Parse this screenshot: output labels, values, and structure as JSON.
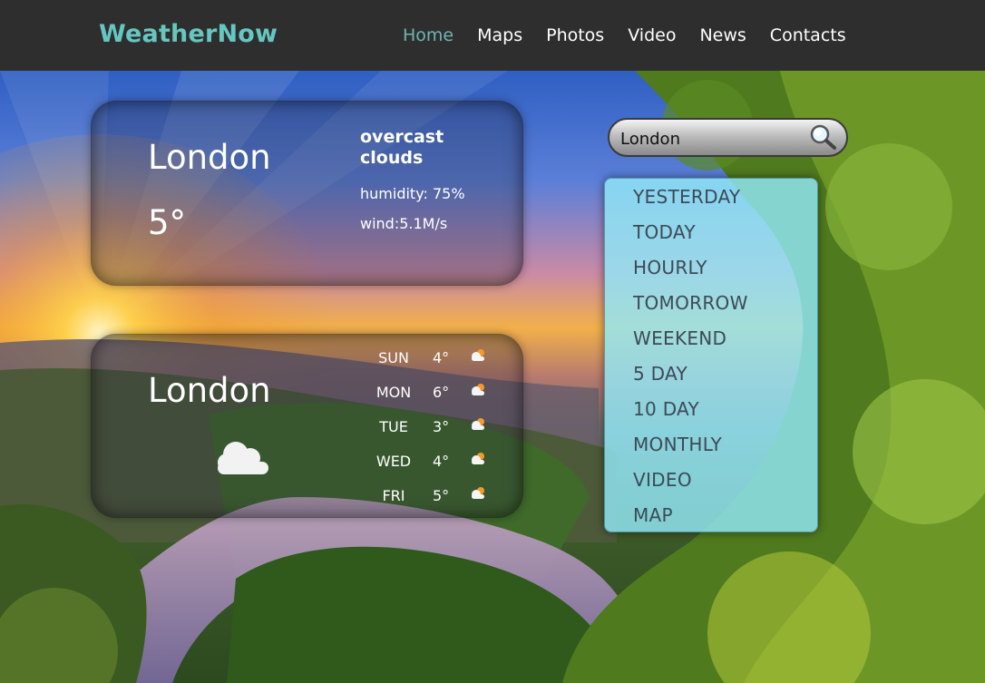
{
  "header": {
    "logo": "WeatherNow",
    "nav": [
      {
        "label": "Home",
        "active": true
      },
      {
        "label": "Maps"
      },
      {
        "label": "Photos"
      },
      {
        "label": "Video"
      },
      {
        "label": "News"
      },
      {
        "label": "Contacts"
      }
    ]
  },
  "current": {
    "city": "London",
    "temp": "5°",
    "condition": "overcast clouds",
    "humidity": "humidity: 75%",
    "wind": "wind:5.1M/s"
  },
  "forecast": {
    "city": "London",
    "icon": "cloud-icon",
    "days": [
      {
        "day": "SUN",
        "temp": "4°",
        "icon": "cloud-sun-icon"
      },
      {
        "day": "MON",
        "temp": "6°",
        "icon": "cloud-sun-icon"
      },
      {
        "day": "TUE",
        "temp": "3°",
        "icon": "cloud-sun-icon"
      },
      {
        "day": "WED",
        "temp": "4°",
        "icon": "cloud-sun-icon"
      },
      {
        "day": "FRI",
        "temp": "5°",
        "icon": "cloud-sun-icon"
      }
    ]
  },
  "search": {
    "value": "London",
    "icon": "search-icon"
  },
  "menu": [
    "YESTERDAY",
    "TODAY",
    "HOURLY",
    "TOMORROW",
    "WEEKEND",
    "5 DAY",
    "10 DAY",
    "MONTHLY",
    "VIDEO",
    "MAP"
  ],
  "colors": {
    "logo": "#66c6c0",
    "nav_active": "#6fb5b0",
    "header_bg": "#2e2e2e",
    "menu_bg": "#91e8f7"
  }
}
